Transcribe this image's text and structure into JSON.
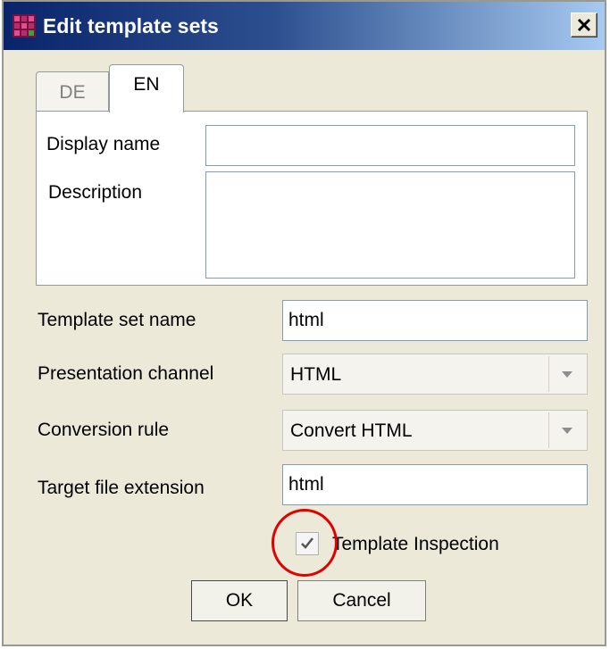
{
  "window": {
    "title": "Edit template sets",
    "icon": "template-app-icon",
    "close_icon": "close-x-icon"
  },
  "tabs": [
    {
      "label": "DE",
      "selected": false
    },
    {
      "label": "EN",
      "selected": true
    }
  ],
  "localized": {
    "display_name_label": "Display name",
    "display_name_value": "",
    "description_label": "Description",
    "description_value": ""
  },
  "form": {
    "template_set_name_label": "Template set name",
    "template_set_name_value": "html",
    "presentation_channel_label": "Presentation channel",
    "presentation_channel_value": "HTML",
    "conversion_rule_label": "Conversion rule",
    "conversion_rule_value": "Convert HTML",
    "target_file_extension_label": "Target file extension",
    "target_file_extension_value": "html",
    "template_inspection_label": "Template Inspection",
    "template_inspection_checked": true
  },
  "buttons": {
    "ok_label": "OK",
    "cancel_label": "Cancel"
  },
  "colors": {
    "titlebar_start": "#0a246a",
    "titlebar_end": "#a6caf0",
    "highlight_ring": "#e00000"
  }
}
